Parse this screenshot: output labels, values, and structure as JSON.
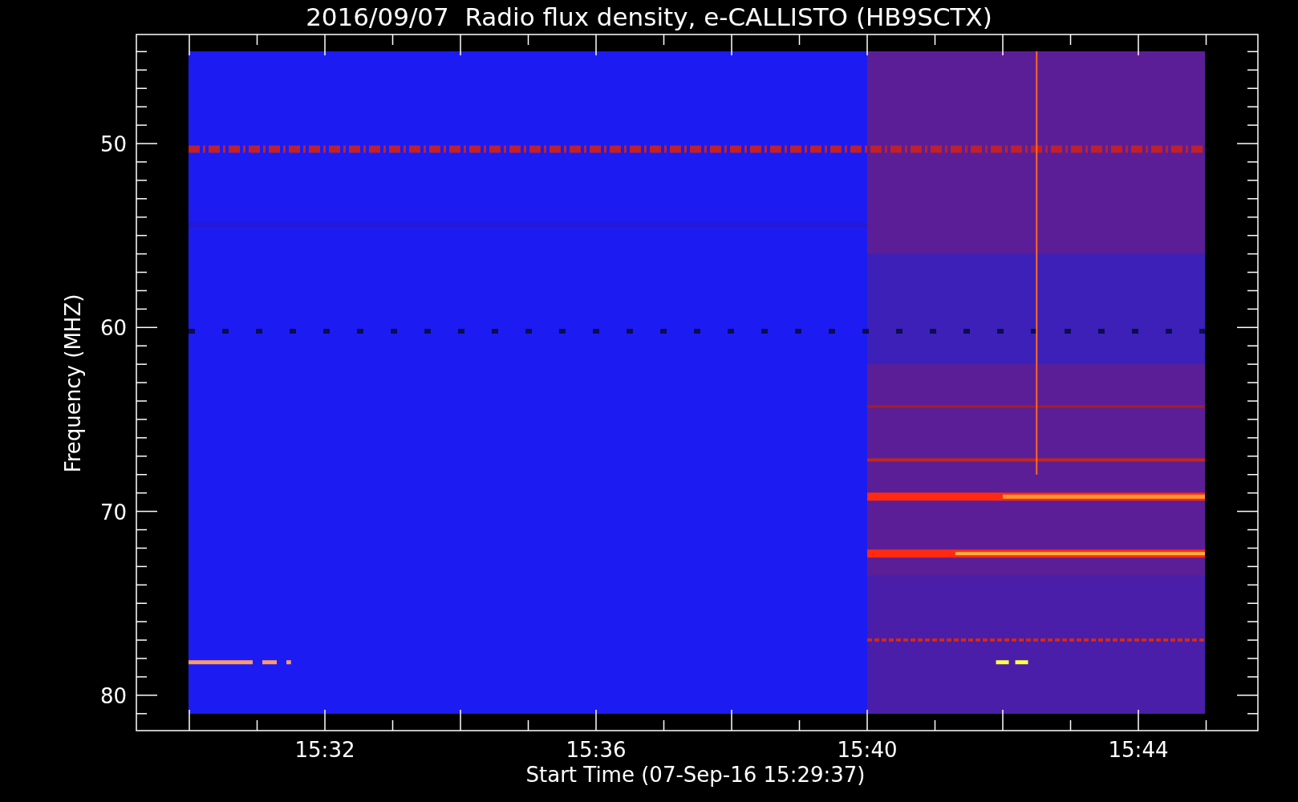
{
  "title": "2016/09/07  Radio flux density, e-CALLISTO (HB9SCTX)",
  "y_axis": {
    "label": "Frequency (MHZ)",
    "ticks": [
      "50",
      "60",
      "70",
      "80"
    ]
  },
  "x_axis": {
    "label": "Start Time (07-Sep-16 15:29:37)",
    "ticks": [
      "15:32",
      "15:36",
      "15:40",
      "15:44"
    ]
  }
}
